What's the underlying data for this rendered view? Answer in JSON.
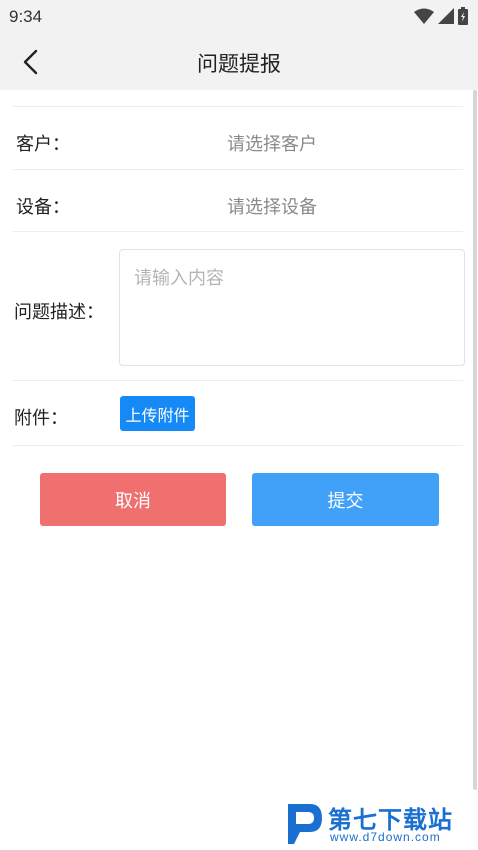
{
  "status_bar": {
    "time": "9:34"
  },
  "nav": {
    "title": "问题提报"
  },
  "form": {
    "customer": {
      "label": "客户：",
      "placeholder": "请选择客户"
    },
    "device": {
      "label": "设备：",
      "placeholder": "请选择设备"
    },
    "description": {
      "label": "问题描述：",
      "placeholder": "请输入内容"
    },
    "attachment": {
      "label": "附件：",
      "button_label": "上传附件"
    }
  },
  "actions": {
    "cancel_label": "取消",
    "submit_label": "提交"
  },
  "colors": {
    "primary_blue": "#1589f5",
    "submit_blue": "#41a1f8",
    "cancel_red": "#f07070",
    "placeholder_gray": "#8a8a8a"
  },
  "watermark": {
    "name": "第七下载站",
    "url": "www.d7down.com"
  }
}
